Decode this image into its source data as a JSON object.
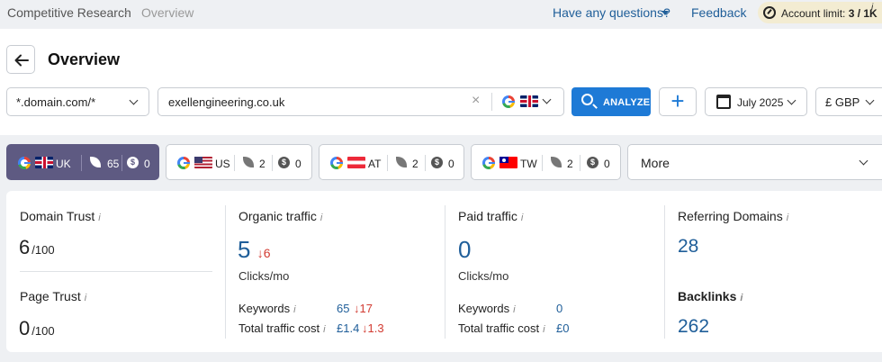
{
  "breadcrumb": {
    "root": "Competitive Research",
    "separator": "›",
    "current": "Overview"
  },
  "top_links": {
    "questions": "Have any questions?",
    "feedback": "Feedback"
  },
  "account_limit": {
    "label": "Account limit:",
    "value": "3 / 1K",
    "info": "i"
  },
  "page": {
    "back_icon": "arrow-left-icon",
    "title": "Overview"
  },
  "search": {
    "mode": "*.domain.com/*",
    "domain": "exellengineering.co.uk",
    "clear": "×",
    "engine_icon": "google-icon",
    "country_icon": "uk-flag-icon",
    "analyze_label": "ANALYZE",
    "add_label": "+",
    "date": "July 2025",
    "currency": "£ GBP"
  },
  "country_tabs": [
    {
      "code": "UK",
      "keywords": "65",
      "paid": "0",
      "active": true
    },
    {
      "code": "US",
      "keywords": "2",
      "paid": "0",
      "active": false
    },
    {
      "code": "AT",
      "keywords": "2",
      "paid": "0",
      "active": false
    },
    {
      "code": "TW",
      "keywords": "2",
      "paid": "0",
      "active": false
    }
  ],
  "more_label": "More",
  "metrics": {
    "domain_trust": {
      "label": "Domain Trust",
      "info": "i",
      "value": "6",
      "suffix": "/100"
    },
    "page_trust": {
      "label": "Page Trust",
      "info": "i",
      "value": "0",
      "suffix": "/100"
    },
    "organic": {
      "label": "Organic traffic",
      "info": "i",
      "value": "5",
      "delta": "↓6",
      "unit": "Clicks/mo",
      "keywords_label": "Keywords",
      "keywords_value": "65",
      "keywords_delta": "↓17",
      "cost_label": "Total traffic cost",
      "cost_value": "£1.4",
      "cost_delta": "↓1.3"
    },
    "paid": {
      "label": "Paid traffic",
      "info": "i",
      "value": "0",
      "unit": "Clicks/mo",
      "keywords_label": "Keywords",
      "keywords_value": "0",
      "cost_label": "Total traffic cost",
      "cost_value": "£0"
    },
    "referring_domains": {
      "label": "Referring Domains",
      "info": "i",
      "value": "28"
    },
    "backlinks": {
      "label": "Backlinks",
      "info": "i",
      "value": "262"
    }
  },
  "colors": {
    "accent": "#1e7ad6",
    "active_tab": "#5e5a82",
    "link": "#1f5e99",
    "negative": "#d23b32"
  }
}
